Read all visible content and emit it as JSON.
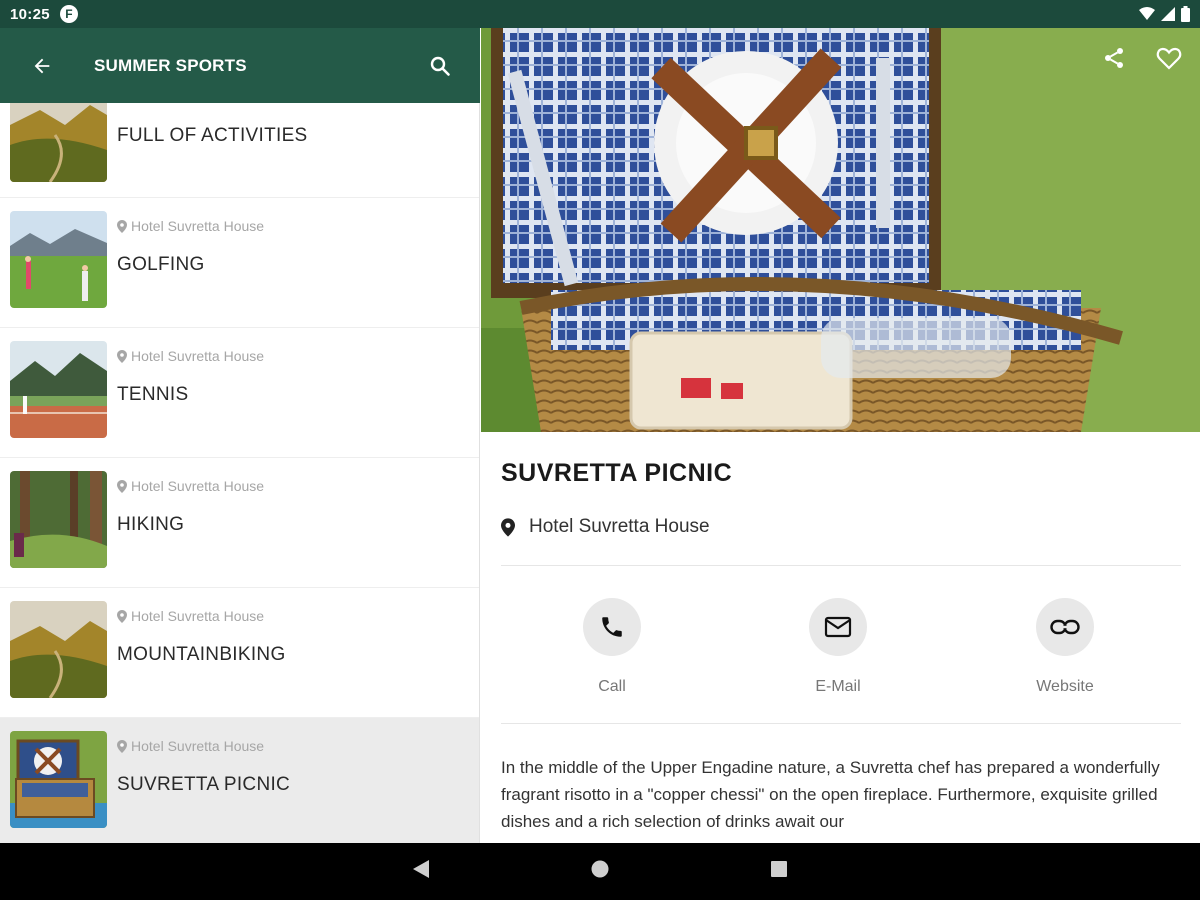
{
  "status_bar": {
    "time": "10:25",
    "notification": "F"
  },
  "app_bar": {
    "title": "SUMMER SPORTS"
  },
  "list": [
    {
      "location": "",
      "name": "FULL OF ACTIVITIES"
    },
    {
      "location": "Hotel Suvretta House",
      "name": "GOLFING"
    },
    {
      "location": "Hotel Suvretta House",
      "name": "TENNIS"
    },
    {
      "location": "Hotel Suvretta House",
      "name": "HIKING"
    },
    {
      "location": "Hotel Suvretta House",
      "name": "MOUNTAINBIKING"
    },
    {
      "location": "Hotel Suvretta House",
      "name": "SUVRETTA PICNIC"
    }
  ],
  "detail": {
    "title": "SUVRETTA PICNIC",
    "location": "Hotel Suvretta House",
    "actions": {
      "call": "Call",
      "email": "E-Mail",
      "website": "Website"
    },
    "description": "In the middle of the Upper Engadine nature, a Suvretta chef has prepared a wonderfully fragrant risotto in a \"copper chessi\" on the open fireplace. Furthermore, exquisite grilled dishes and a rich selection of drinks await our"
  },
  "colors": {
    "status_bar": "#1c4a3c",
    "app_bar": "#245a48",
    "selected_row": "#ebebeb"
  }
}
